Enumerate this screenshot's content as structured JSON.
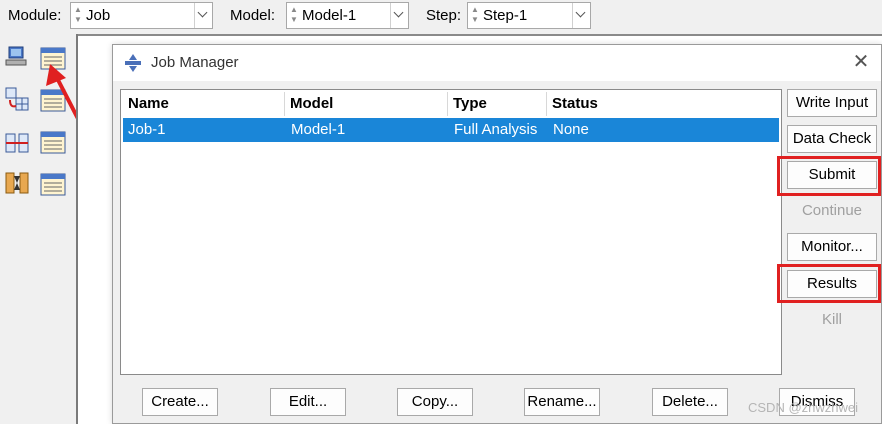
{
  "toolbar": {
    "module_label": "Module:",
    "module_value": "Job",
    "model_label": "Model:",
    "model_value": "Model-1",
    "step_label": "Step:",
    "step_value": "Step-1"
  },
  "dialog": {
    "title": "Job Manager",
    "columns": [
      "Name",
      "Model",
      "Type",
      "Status"
    ],
    "rows": [
      {
        "name": "Job-1",
        "model": "Model-1",
        "type": "Full Analysis",
        "status": "None",
        "selected": true
      }
    ],
    "side_buttons": {
      "write_input": "Write Input",
      "data_check": "Data Check",
      "submit": "Submit",
      "continue": "Continue",
      "monitor": "Monitor...",
      "results": "Results",
      "kill": "Kill"
    },
    "bottom_buttons": {
      "create": "Create...",
      "edit": "Edit...",
      "copy": "Copy...",
      "rename": "Rename...",
      "delete": "Delete...",
      "dismiss": "Dismiss"
    }
  },
  "watermark": "CSDN @zhwzhwei",
  "colors": {
    "selection": "#1a86d8",
    "highlight": "#e02020",
    "annotation_arrow": "#e02020"
  }
}
